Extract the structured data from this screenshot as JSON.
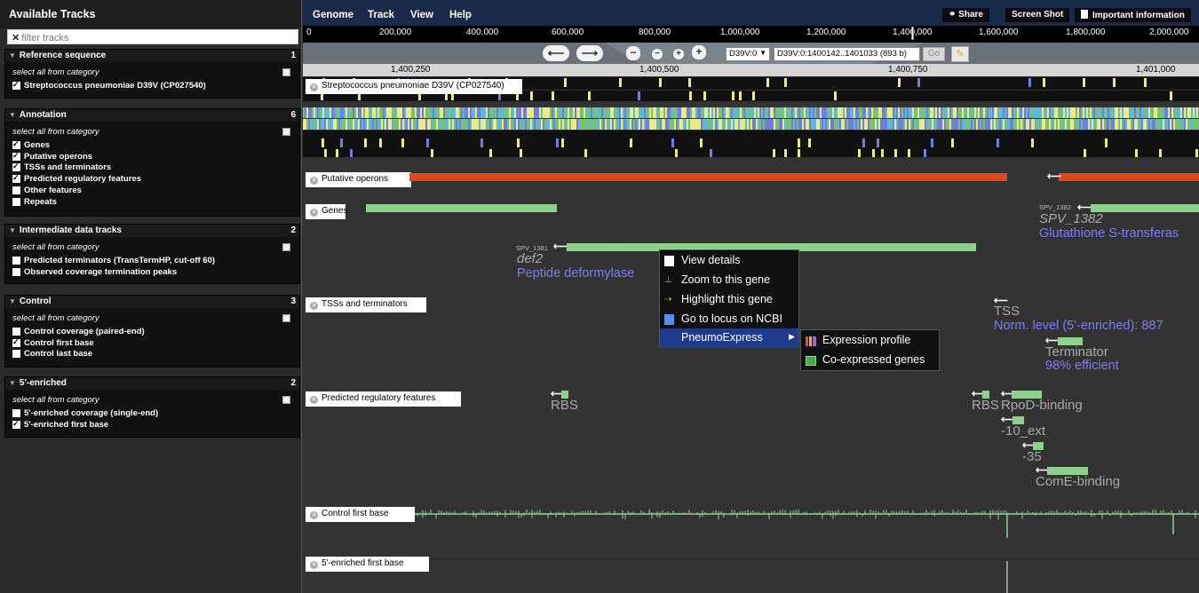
{
  "sidebar": {
    "title": "Available Tracks",
    "filter_placeholder": "filter tracks",
    "select_all_label": "select all from category",
    "categories": [
      {
        "name": "Reference sequence",
        "count": "1",
        "tracks": [
          {
            "label": "Streptococcus pneumoniae D39V (CP027540)",
            "checked": true
          }
        ]
      },
      {
        "name": "Annotation",
        "count": "6",
        "tracks": [
          {
            "label": "Genes",
            "checked": true
          },
          {
            "label": "Putative operons",
            "checked": true
          },
          {
            "label": "TSSs and terminators",
            "checked": true
          },
          {
            "label": "Predicted regulatory features",
            "checked": true
          },
          {
            "label": "Other features",
            "checked": false
          },
          {
            "label": "Repeats",
            "checked": false
          }
        ]
      },
      {
        "name": "Intermediate data tracks",
        "count": "2",
        "tracks": [
          {
            "label": "Predicted terminators (TransTermHP, cut-off 60)",
            "checked": false
          },
          {
            "label": "Observed coverage termination peaks",
            "checked": false
          }
        ]
      },
      {
        "name": "Control",
        "count": "3",
        "tracks": [
          {
            "label": "Control coverage (paired-end)",
            "checked": false
          },
          {
            "label": "Control first base",
            "checked": true
          },
          {
            "label": "Control last base",
            "checked": false
          }
        ]
      },
      {
        "name": "5'-enriched",
        "count": "2",
        "tracks": [
          {
            "label": "5'-enriched coverage (single-end)",
            "checked": false
          },
          {
            "label": "5'-enriched first base",
            "checked": true
          }
        ]
      }
    ]
  },
  "menubar": {
    "items": [
      "Genome",
      "Track",
      "View",
      "Help"
    ],
    "share": "Share",
    "screenshot": "Screen Shot",
    "important": "Important information"
  },
  "overview_ticks": [
    "0",
    "200,000",
    "400,000",
    "600,000",
    "800,000",
    "1,000,000",
    "1,200,000",
    "1,400,000",
    "1,600,000",
    "1,800,000",
    "2,000,000"
  ],
  "nav": {
    "refseq": "D39V:0",
    "location": "D39V:0:1400142..1401033 (893 b)",
    "go": "Go"
  },
  "ruler_ticks": [
    "1,400,250",
    "1,400,500",
    "1,400,750",
    "1,401,000"
  ],
  "tracks": {
    "refseq": "Streptococcus pneumoniae D39V (CP027540)",
    "operons": "Putative operons",
    "genes": "Genes",
    "tss": "TSSs and terminators",
    "regulatory": "Predicted regulatory features",
    "control_first": "Control first base",
    "enriched_first": "5'-enriched first base"
  },
  "features": {
    "spv1381_id": "SPV_1381",
    "spv1381_name": "def2",
    "spv1381_desc": "Peptide deformylase",
    "spv1382_id": "SPV_1382",
    "spv1382_name": "SPV_1382",
    "spv1382_desc": "Glutathione S-transferas",
    "tss_name": "TSS",
    "tss_desc": "Norm. level (5'-enriched): 887",
    "term_name": "Terminator",
    "term_desc": "98% efficient",
    "rbs1": "RBS",
    "rbs2": "RBS",
    "rpod": "RpoD-binding",
    "ext10": "-10_ext",
    "m35": "-35",
    "come": "ComE-binding"
  },
  "context_menu": {
    "items": [
      "View details",
      "Zoom to this gene",
      "Highlight this gene",
      "Go to locus on NCBI",
      "PneumoExpress"
    ],
    "submenu": [
      "Expression profile",
      "Co-expressed genes"
    ]
  },
  "colors": {
    "operon": "#e0481d",
    "gene": "#8fd08f",
    "seq_a": "#eaea8a",
    "seq_c": "#6f7fe0",
    "seq_g": "#79c46a",
    "seq_t": "#5fb8d8",
    "menu_highlight": "#1f3b8c"
  }
}
